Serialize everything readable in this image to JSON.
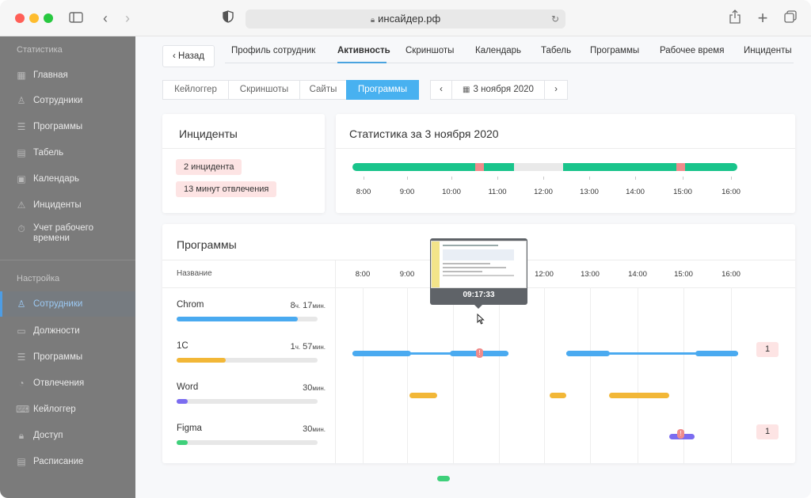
{
  "browser": {
    "url": "инсайдер.рф",
    "icons": [
      "sidebar-toggle-icon",
      "back-arrow-icon",
      "forward-arrow-icon",
      "shield-icon",
      "lock-icon",
      "reload-icon",
      "share-icon",
      "plus-icon",
      "tabs-icon"
    ]
  },
  "sidebar": {
    "section_stats": "Статистика",
    "section_settings": "Настройка",
    "items_stats": [
      {
        "label": "Главная",
        "icon": "grid-icon"
      },
      {
        "label": "Сотрудники",
        "icon": "user-icon"
      },
      {
        "label": "Программы",
        "icon": "list-icon"
      },
      {
        "label": "Табель",
        "icon": "table-icon"
      },
      {
        "label": "Календарь",
        "icon": "calendar-icon"
      },
      {
        "label": "Инциденты",
        "icon": "warning-icon"
      },
      {
        "label": "Учет рабочего времени",
        "icon": "stopwatch-icon"
      }
    ],
    "items_settings": [
      {
        "label": "Сотрудники",
        "icon": "user-icon",
        "active": true
      },
      {
        "label": "Должности",
        "icon": "id-card-icon"
      },
      {
        "label": "Программы",
        "icon": "list-icon"
      },
      {
        "label": "Отвлечения",
        "icon": "clock-icon"
      },
      {
        "label": "Кейлоггер",
        "icon": "keyboard-icon"
      },
      {
        "label": "Доступ",
        "icon": "lock-icon"
      },
      {
        "label": "Расписание",
        "icon": "schedule-icon"
      }
    ]
  },
  "nav": {
    "back": "‹ Назад",
    "tabs": [
      "Профиль сотрудник",
      "Активность",
      "Скриншоты",
      "Календарь",
      "Табель",
      "Программы",
      "Рабочее время",
      "Инциденты"
    ],
    "active_tab": "Активность"
  },
  "subtabs": {
    "items": [
      "Кейлоггер",
      "Скриншоты",
      "Сайты",
      "Программы"
    ],
    "active": "Программы",
    "date": "3 ноября 2020",
    "prev": "‹",
    "next": "›"
  },
  "incidents": {
    "title": "Инциденты",
    "pills": [
      "2 инцидента",
      "13 минут отвлечения"
    ]
  },
  "stats": {
    "title": "Статистика за 3 ноября 2020",
    "hours": [
      "8:00",
      "9:00",
      "10:00",
      "11:00",
      "12:00",
      "13:00",
      "14:00",
      "15:00",
      "16:00"
    ],
    "colors": {
      "work": "#19c48b",
      "idle": "#e9e9e9",
      "incident": "#f08b8b"
    }
  },
  "programs": {
    "title": "Программы",
    "col_name": "Название",
    "hours": [
      "8:00",
      "9:00",
      "10:00",
      "11:00",
      "12:00",
      "13:00",
      "14:00",
      "15:00",
      "16:00"
    ],
    "tooltip_time": "09:17:33",
    "rows": [
      {
        "name": "Chrom",
        "time": "8",
        "time_unit": "ч.",
        "time_min": "17",
        "min_unit": "мин.",
        "share": 0.86,
        "color": "#4aaaf0",
        "badge": "1"
      },
      {
        "name": "1C",
        "time": "1",
        "time_unit": "ч.",
        "time_min": "57",
        "min_unit": "мин.",
        "share": 0.35,
        "color": "#f2b737",
        "badge": ""
      },
      {
        "name": "Word",
        "time": "",
        "time_unit": "",
        "time_min": "30",
        "min_unit": "мин.",
        "share": 0.08,
        "color": "#7b6cf0",
        "badge": "1"
      },
      {
        "name": "Figma",
        "time": "",
        "time_unit": "",
        "time_min": "30",
        "min_unit": "мин.",
        "share": 0.08,
        "color": "#3ed07a",
        "badge": ""
      }
    ],
    "marker_symbol": "!"
  }
}
